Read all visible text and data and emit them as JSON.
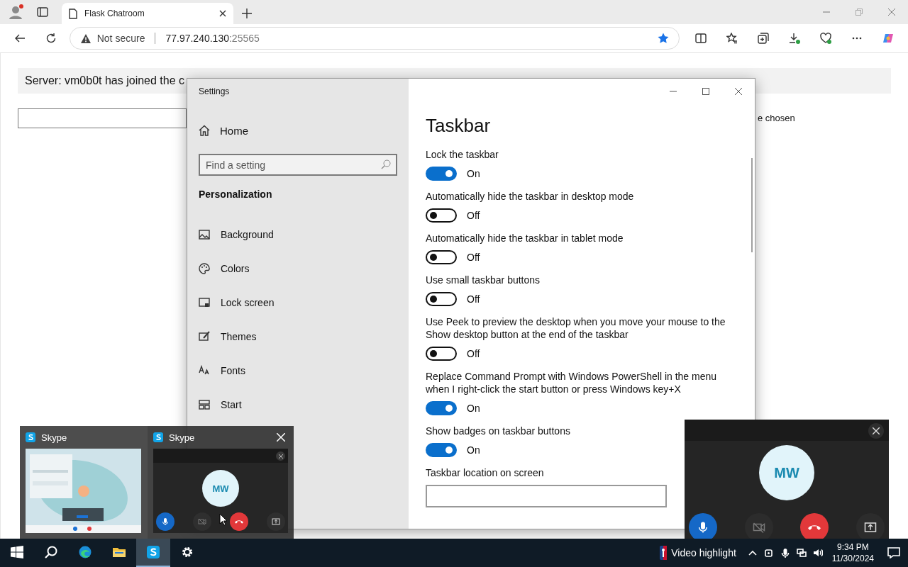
{
  "browser": {
    "tab": {
      "title": "Flask Chatroom"
    },
    "security": "Not secure",
    "host": "77.97.240.130",
    "port": ":25565",
    "favorite": true
  },
  "page": {
    "message": "Server: vm0b0t has joined the c",
    "file_status": "e chosen"
  },
  "settings": {
    "title": "Settings",
    "home": "Home",
    "search": {
      "placeholder": "Find a setting"
    },
    "section": "Personalization",
    "nav": [
      {
        "kind": "background",
        "label": "Background"
      },
      {
        "kind": "colors",
        "label": "Colors"
      },
      {
        "kind": "lock",
        "label": "Lock screen"
      },
      {
        "kind": "themes",
        "label": "Themes"
      },
      {
        "kind": "fonts",
        "label": "Fonts"
      },
      {
        "kind": "start",
        "label": "Start"
      }
    ],
    "heading": "Taskbar",
    "options": [
      {
        "label": "Lock the taskbar",
        "on": true,
        "state": "On"
      },
      {
        "label": "Automatically hide the taskbar in desktop mode",
        "on": false,
        "state": "Off"
      },
      {
        "label": "Automatically hide the taskbar in tablet mode",
        "on": false,
        "state": "Off"
      },
      {
        "label": "Use small taskbar buttons",
        "on": false,
        "state": "Off"
      },
      {
        "label": "Use Peek to preview the desktop when you move your mouse to the Show desktop button at the end of the taskbar",
        "on": false,
        "state": "Off"
      },
      {
        "label": "Replace Command Prompt with Windows PowerShell in the menu when I right-click the start button or press Windows key+X",
        "on": true,
        "state": "On"
      },
      {
        "label": "Show badges on taskbar buttons",
        "on": true,
        "state": "On"
      }
    ],
    "next_label": "Taskbar location on screen"
  },
  "previews": [
    {
      "kind": "picture",
      "title": "Skype"
    },
    {
      "kind": "call",
      "title": "Skype",
      "initials": "MW"
    }
  ],
  "call": {
    "initials": "MW"
  },
  "taskbar": {
    "apps": [
      {
        "kind": "start",
        "selected": false
      },
      {
        "kind": "search",
        "selected": false
      },
      {
        "kind": "edge",
        "selected": false
      },
      {
        "kind": "explorer",
        "selected": false
      },
      {
        "kind": "skype",
        "selected": true
      },
      {
        "kind": "settings",
        "selected": false
      }
    ],
    "news": "Video highlight",
    "time": "9:34 PM",
    "date": "11/30/2024"
  }
}
